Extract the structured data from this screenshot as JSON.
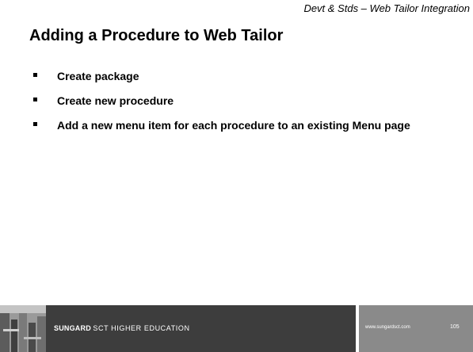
{
  "slide": {
    "header_note": "Devt & Stds – Web Tailor Integration",
    "title": "Adding a Procedure to Web Tailor",
    "bullets": [
      "Create package",
      "Create new procedure",
      "Add a new menu item for each procedure to an existing Menu page"
    ]
  },
  "footer": {
    "brand_strong": "SUNGARD",
    "brand_rest": "SCT HIGHER EDUCATION",
    "url": "www.sungardsct.com",
    "page_number": "105"
  },
  "colors": {
    "footer_band": "#3d3d3d",
    "footer_right": "#8a8a8a",
    "text": "#000000"
  }
}
